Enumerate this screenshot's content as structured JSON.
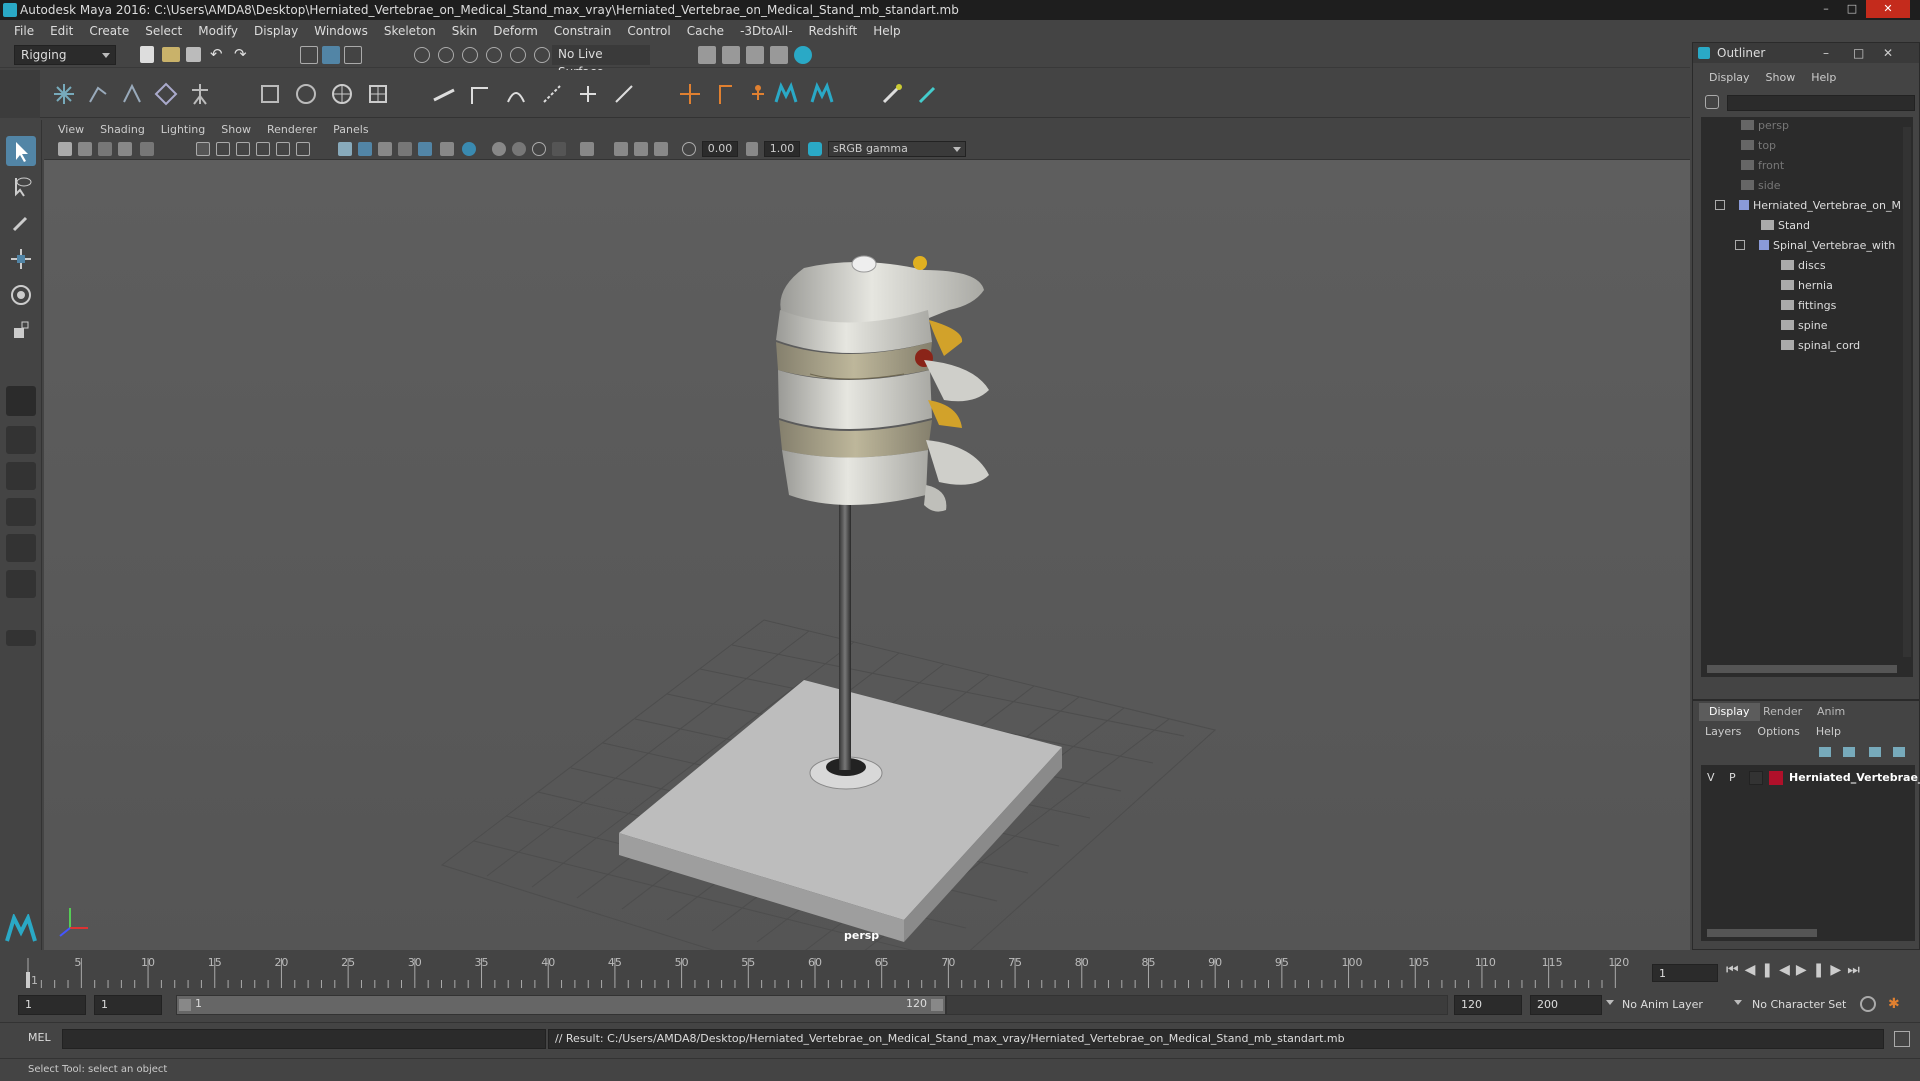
{
  "window": {
    "title": "Autodesk Maya 2016: C:\\Users\\AMDA8\\Desktop\\Herniated_Vertebrae_on_Medical_Stand_max_vray\\Herniated_Vertebrae_on_Medical_Stand_mb_standart.mb"
  },
  "menubar": [
    "File",
    "Edit",
    "Create",
    "Select",
    "Modify",
    "Display",
    "Windows",
    "Skeleton",
    "Skin",
    "Deform",
    "Constrain",
    "Control",
    "Cache",
    "-3DtoAll-",
    "Redshift",
    "Help"
  ],
  "statusline": {
    "menuset": "Rigging",
    "live_surface": "No Live Surface"
  },
  "viewport": {
    "menu": [
      "View",
      "Shading",
      "Lighting",
      "Show",
      "Renderer",
      "Panels"
    ],
    "near_value": "0.00",
    "far_value": "1.00",
    "color_space": "sRGB gamma",
    "camera_label": "persp"
  },
  "outliner": {
    "title": "Outliner",
    "menu": [
      "Display",
      "Show",
      "Help"
    ],
    "items": [
      {
        "label": "persp",
        "dim": true,
        "depth": 0,
        "icon": "camera-icon"
      },
      {
        "label": "top",
        "dim": true,
        "depth": 0,
        "icon": "camera-icon"
      },
      {
        "label": "front",
        "dim": true,
        "depth": 0,
        "icon": "camera-icon"
      },
      {
        "label": "side",
        "dim": true,
        "depth": 0,
        "icon": "camera-icon"
      },
      {
        "label": "Herniated_Vertebrae_on_M",
        "dim": false,
        "depth": 0,
        "icon": "group-icon"
      },
      {
        "label": "Stand",
        "dim": false,
        "depth": 1,
        "icon": "mesh-icon"
      },
      {
        "label": "Spinal_Vertebrae_with",
        "dim": false,
        "depth": 1,
        "icon": "group-icon"
      },
      {
        "label": "discs",
        "dim": false,
        "depth": 2,
        "icon": "mesh-icon"
      },
      {
        "label": "hernia",
        "dim": false,
        "depth": 2,
        "icon": "mesh-icon"
      },
      {
        "label": "fittings",
        "dim": false,
        "depth": 2,
        "icon": "mesh-icon"
      },
      {
        "label": "spine",
        "dim": false,
        "depth": 2,
        "icon": "mesh-icon"
      },
      {
        "label": "spinal_cord",
        "dim": false,
        "depth": 2,
        "icon": "mesh-icon"
      }
    ]
  },
  "layers": {
    "tabs": [
      "Display",
      "Render",
      "Anim"
    ],
    "menu": [
      "Layers",
      "Options",
      "Help"
    ],
    "layer": {
      "v": "V",
      "p": "P",
      "name": "Herniated_Vertebrae_o",
      "color": "#b0102a"
    }
  },
  "timeline": {
    "ticks": [
      "1",
      "5",
      "10",
      "15",
      "20",
      "25",
      "30",
      "35",
      "40",
      "45",
      "50",
      "55",
      "60",
      "65",
      "70",
      "75",
      "80",
      "85",
      "90",
      "95",
      "100",
      "105",
      "110",
      "115",
      "120"
    ],
    "current_frame": "1"
  },
  "range": {
    "start": "1",
    "playback_start": "1",
    "slider_start": "1",
    "slider_end": "120",
    "playback_end": "120",
    "end": "200",
    "anim_layer": "No Anim Layer",
    "char_set": "No Character Set"
  },
  "cmdline": {
    "lang": "MEL",
    "result": "// Result: C:/Users/AMDA8/Desktop/Herniated_Vertebrae_on_Medical_Stand_max_vray/Herniated_Vertebrae_on_Medical_Stand_mb_standart.mb"
  },
  "helpline": "Select Tool: select an object",
  "colors": {
    "accent": "#5285a6",
    "maya_teal": "#2aa9c6",
    "layer_red": "#b0102a"
  }
}
